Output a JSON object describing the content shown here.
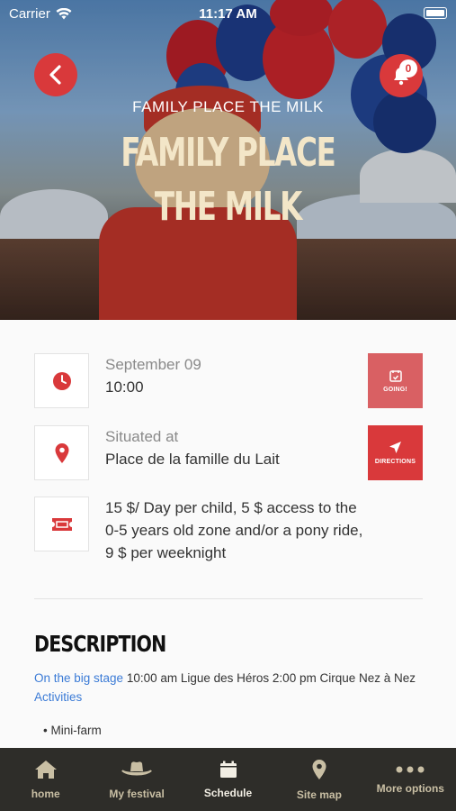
{
  "status_bar": {
    "carrier": "Carrier",
    "time": "11:17 AM"
  },
  "hero": {
    "subtitle": "FAMILY PLACE THE MILK",
    "title": "FAMILY PLACE THE MILK",
    "notification_count": "0"
  },
  "schedule": {
    "date": "September 09",
    "time": "10:00",
    "going_label": "GOING!"
  },
  "location": {
    "label": "Situated at",
    "place": "Place de la famille du Lait",
    "directions_label": "DIRECTIONS"
  },
  "pricing": {
    "text": "15 $/ Day per child, 5 $ access to the 0-5 years old zone and/or a pony ride, 9 $ per weeknight"
  },
  "description": {
    "title": "DESCRIPTION",
    "link_big_stage": "On the big stage",
    "text_part1": " 10:00 am  Ligue des Héros 2:00 pm   Cirque Nez à Nez ",
    "link_activities": "Activities",
    "list_item_1": "• Mini-farm"
  },
  "tabbar": {
    "items": [
      {
        "label": "home",
        "icon": "home-icon"
      },
      {
        "label": "My festival",
        "icon": "cowboy-hat-icon"
      },
      {
        "label": "Schedule",
        "icon": "calendar-icon"
      },
      {
        "label": "Site map",
        "icon": "map-pin-icon"
      },
      {
        "label": "More options",
        "icon": "more-icon"
      }
    ]
  },
  "colors": {
    "accent": "#d9393b",
    "tabbar_bg": "#2e2d29",
    "link": "#3b7bd6"
  }
}
